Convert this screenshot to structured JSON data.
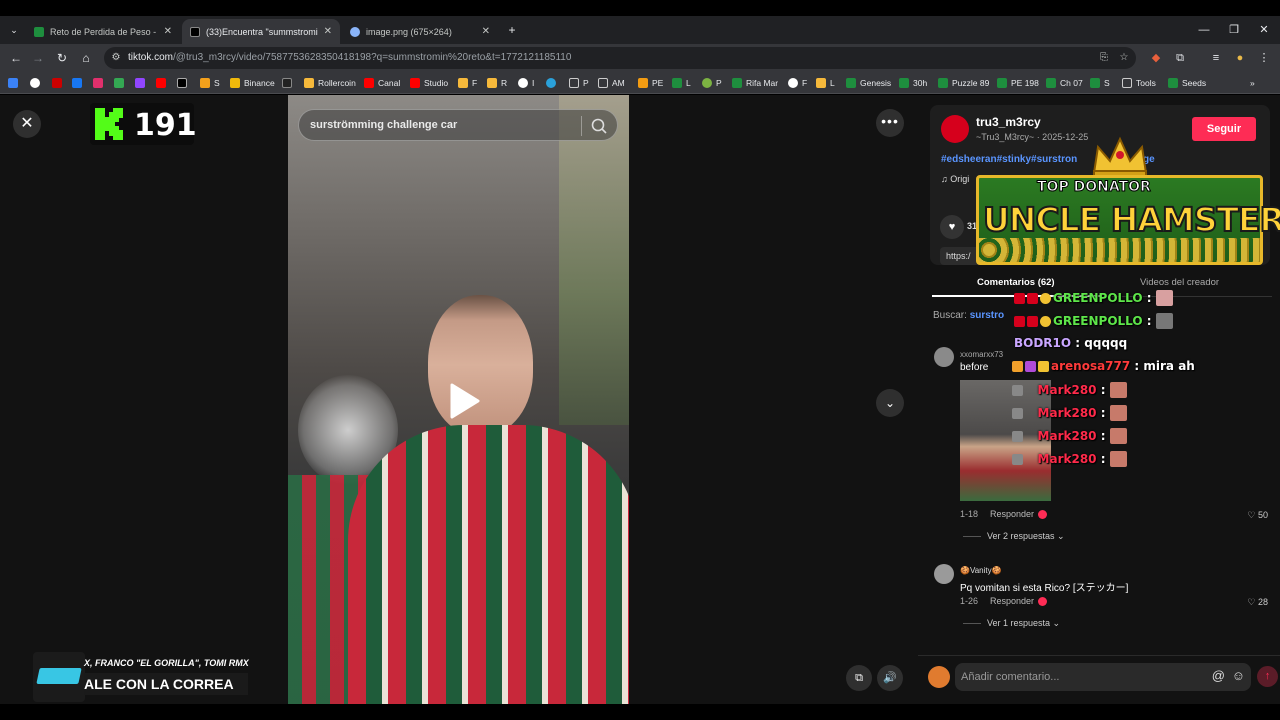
{
  "browser": {
    "tabs": [
      {
        "title": "Reto de Perdida de Peso - El Me",
        "favicon": "green-sheet",
        "active": false
      },
      {
        "title": "(33)Encuentra \"summstromin re",
        "favicon": "tiktok",
        "active": true
      },
      {
        "title": "image.png (675×264)",
        "favicon": "globe",
        "active": false
      }
    ],
    "new_tab": "+",
    "url_host": "tiktok.com",
    "url_path": "/@tru3_m3rcy/video/7587753628350418198?q=summstromin%20reto&t=1772121185110",
    "bookmarks": [
      "S",
      "Binance",
      "Rollercoin",
      "Canal",
      "Studio",
      "F",
      "R",
      "I",
      "P",
      "AM",
      "PE",
      "L",
      "P",
      "Rifa Mar",
      "F",
      "L",
      "Genesis",
      "30h",
      "Puzzle 89",
      "PE 198",
      "Ch 07",
      "S",
      "Tools",
      "Seeds"
    ]
  },
  "overlay": {
    "kick_count": "191",
    "lower_third_top": "X, FRANCO \"EL GORILLA\", TOMI RMX",
    "lower_third_bottom": "ALE CON LA CORREA",
    "banner_top": "TOP DONATOR",
    "banner_name": "UNCLE HAMSTER",
    "chat": [
      {
        "user": "GREENPOLLO",
        "text": "",
        "color": "#5ee64a"
      },
      {
        "user": "GREENPOLLO",
        "text": "",
        "color": "#5ee64a"
      },
      {
        "user": "BODR1O",
        "text": "qqqqq",
        "color": "#c9a6ff"
      },
      {
        "user": "arenosa777",
        "text": "mira ah",
        "color": "#ff3b3b"
      },
      {
        "user": "Mark280",
        "text": "",
        "color": "#ff2a4a"
      },
      {
        "user": "Mark280",
        "text": "",
        "color": "#ff2a4a"
      },
      {
        "user": "Mark280",
        "text": "",
        "color": "#ff2a4a"
      },
      {
        "user": "Mark280",
        "text": "",
        "color": "#ff2a4a"
      }
    ]
  },
  "video": {
    "search_query": "surströmming challenge car"
  },
  "panel": {
    "username": "tru3_m3rcy",
    "subline": "~Tru3_M3rcy~ · 2025-12-25",
    "follow": "Seguir",
    "description": "#edsheeran#stinky#surstron",
    "description_tail": "ge",
    "music": "Origi",
    "like_count": "31",
    "link": "https:/",
    "tab_comments": "Comentarios (62)",
    "tab_videos": "Videos del creador",
    "search_label": "Buscar:",
    "search_term": "surstro",
    "comments": [
      {
        "user": "xxomarxx73",
        "text": "before",
        "date": "1-18",
        "reply": "Responder",
        "likes": "50",
        "replies": "Ver 2 respuestas"
      },
      {
        "user": "🍪Vanity🍪",
        "text": "Pq vomitan si esta Rico? [ステッカー]",
        "date": "1-26",
        "reply": "Responder",
        "likes": "28",
        "replies": "Ver 1 respuesta"
      }
    ],
    "comment_placeholder": "Añadir comentario..."
  }
}
